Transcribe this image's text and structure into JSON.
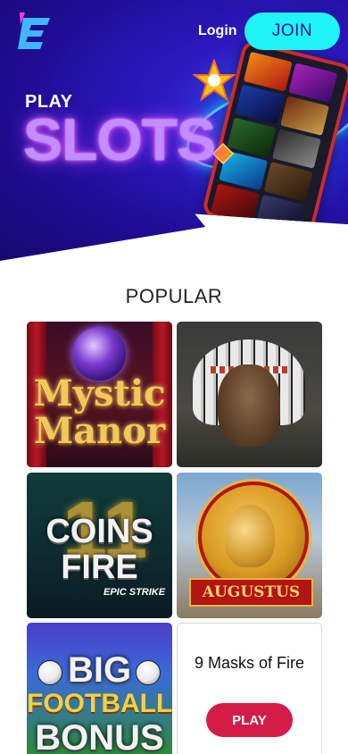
{
  "header": {
    "login_label": "Login",
    "join_label": "JOIN",
    "logo_icon": "e-logo-icon",
    "join_bg": "#1ff4f8",
    "join_text_color": "#1b1496"
  },
  "hero": {
    "play_text": "PLAY",
    "slots_text": "SLOTS",
    "phone_icon": "phone-slots-icon"
  },
  "popular": {
    "heading": "POPULAR",
    "games": [
      {
        "title_line1": "Mystic",
        "title_line2": "Manor"
      },
      {
        "title_line1": "",
        "title_line2": ""
      },
      {
        "title_line1": "COINS",
        "title_line2": "FIRE",
        "badge": "EPIC STRIKE",
        "big_number": "11"
      },
      {
        "title": "AUGUSTUS"
      },
      {
        "line1": "BIG",
        "line2": "FOOTBALL",
        "line3": "BONUS"
      },
      {
        "title": "9 Masks of Fire",
        "play_label": "PLAY"
      }
    ]
  },
  "colors": {
    "accent_red": "#d41c48",
    "hero_bg": "#1d0c8e"
  }
}
